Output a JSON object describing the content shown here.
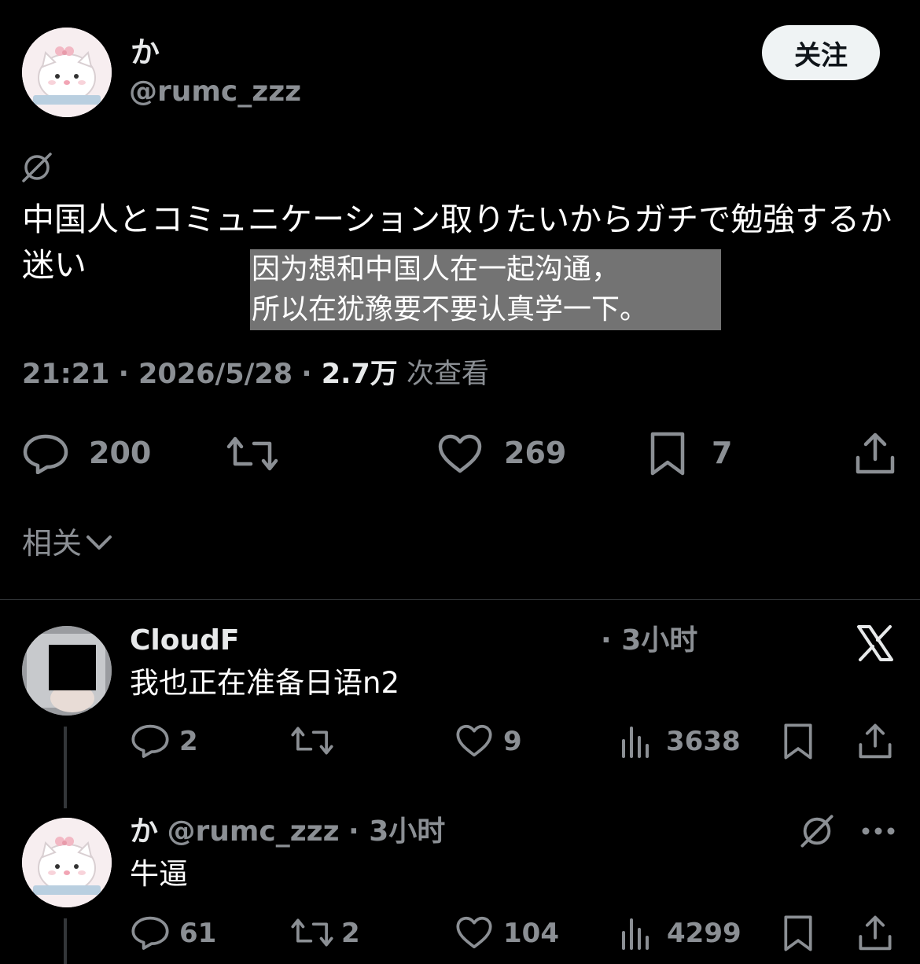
{
  "post": {
    "author_name": "か",
    "author_handle": "@rumc_zzz",
    "follow_label": "关注",
    "text": "中国人とコミュニケーション取りたいからガチで勉強するか迷い",
    "translation_line1": "因为想和中国人在一起沟通，",
    "translation_line2": "所以在犹豫要不要认真学一下。",
    "time": "21:21",
    "date": "2026/5/28",
    "views_count": "2.7万",
    "views_label": "次查看",
    "replies": "200",
    "likes": "269",
    "bookmarks": "7",
    "related_label": "相关"
  },
  "replies": [
    {
      "author_name": "CloudF",
      "time": "· 3小时",
      "text": "我也正在准备日语n2",
      "replies": "2",
      "retweets": "",
      "likes": "9",
      "views": "3638"
    },
    {
      "author_name": "か",
      "author_handle": "@rumc_zzz",
      "time": "· 3小时",
      "text": "牛逼",
      "replies": "61",
      "retweets": "2",
      "likes": "104",
      "views": "4299"
    }
  ],
  "icons": {
    "avatar_main": "cat-avatar",
    "no_translate": "slashed-circle-icon",
    "reply": "reply-icon",
    "retweet": "retweet-icon",
    "like": "heart-icon",
    "bookmark": "bookmark-icon",
    "share": "share-icon",
    "views": "views-icon",
    "x_logo": "x-logo-icon",
    "more": "more-icon",
    "chevron": "chevron-down-icon"
  },
  "colors": {
    "background": "#000000",
    "text": "#e7e9ea",
    "muted": "#71767b",
    "follow_bg": "#eff3f4"
  }
}
